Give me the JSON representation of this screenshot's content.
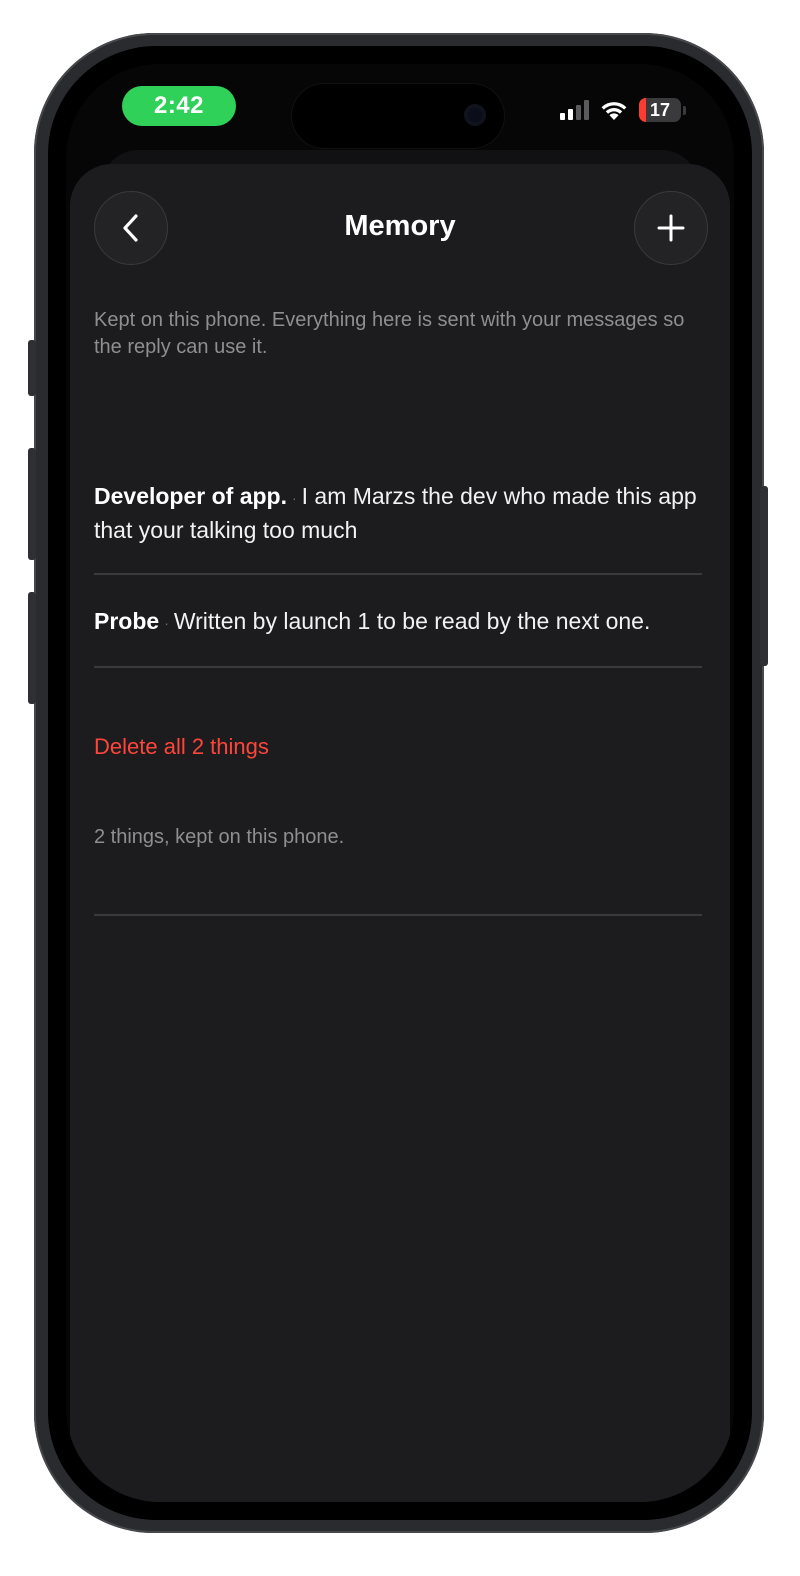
{
  "status_bar": {
    "time": "2:42",
    "battery_level": "17",
    "colors": {
      "time_pill": "#2fd158",
      "battery_low": "#ff3b30"
    }
  },
  "header": {
    "title": "Memory",
    "back_icon": "chevron-left-icon",
    "add_icon": "plus-icon"
  },
  "intro": "Kept on this phone. Everything here is sent with your messages so the reply can use it.",
  "memories": [
    {
      "label": "Developer of app.",
      "text": "I am Marzs the dev who made this app that your talking too much"
    },
    {
      "label": "Probe",
      "text": "Written by launch 1 to be read by the next one."
    }
  ],
  "delete_all_label": "Delete all 2 things",
  "footer": "2 things, kept on this phone.",
  "colors": {
    "background": "#1c1c1e",
    "destructive": "#ff453a",
    "secondary_text": "#8e8e93"
  }
}
